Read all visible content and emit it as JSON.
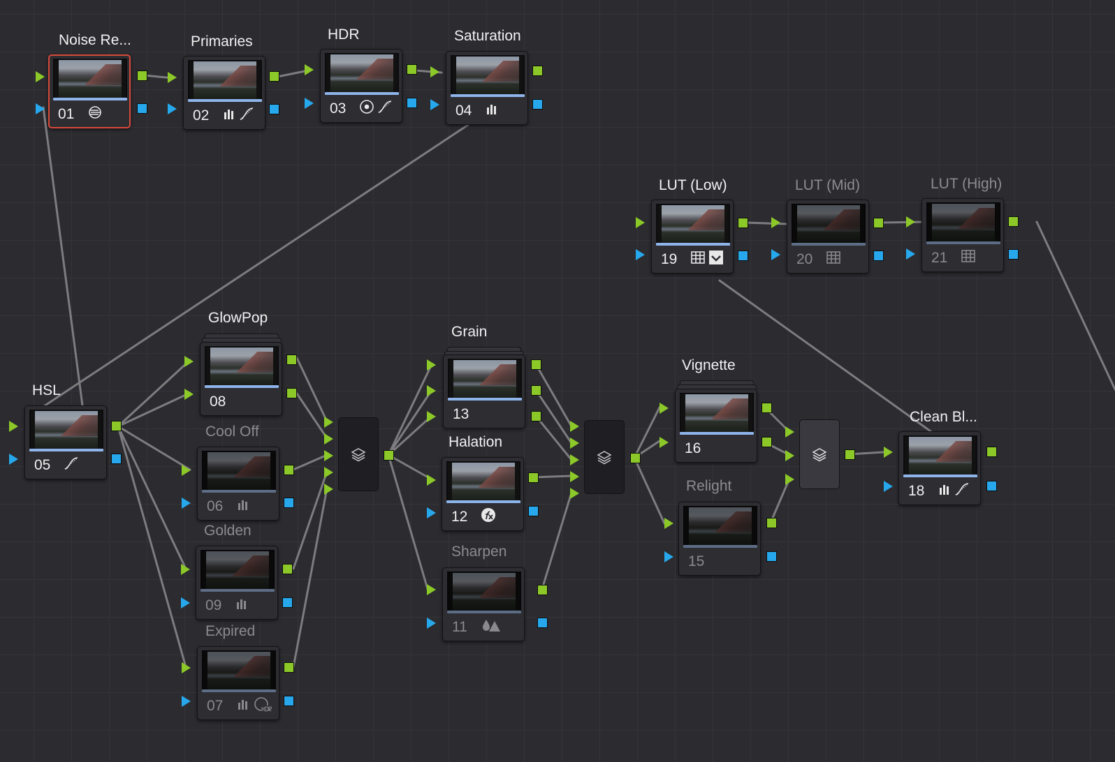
{
  "nodes": {
    "n01": {
      "label": "Noise Re...",
      "num": "01"
    },
    "n02": {
      "label": "Primaries",
      "num": "02"
    },
    "n03": {
      "label": "HDR",
      "num": "03"
    },
    "n04": {
      "label": "Saturation",
      "num": "04"
    },
    "n05": {
      "label": "HSL",
      "num": "05"
    },
    "n06": {
      "label": "Cool Off",
      "num": "06"
    },
    "n07": {
      "label": "Expired",
      "num": "07"
    },
    "n08": {
      "label": "GlowPop",
      "num": "08"
    },
    "n09": {
      "label": "Golden",
      "num": "09"
    },
    "n11": {
      "label": "Sharpen",
      "num": "11"
    },
    "n12": {
      "label": "Halation",
      "num": "12"
    },
    "n13": {
      "label": "Grain",
      "num": "13"
    },
    "n15": {
      "label": "Relight",
      "num": "15"
    },
    "n16": {
      "label": "Vignette",
      "num": "16"
    },
    "n18": {
      "label": "Clean Bl...",
      "num": "18"
    },
    "n19": {
      "label": "LUT (Low)",
      "num": "19"
    },
    "n20": {
      "label": "LUT (Mid)",
      "num": "20"
    },
    "n21": {
      "label": "LUT (High)",
      "num": "21"
    }
  },
  "colors": {
    "background": "#2b2b30",
    "rgb_connector": "#8cc928",
    "alpha_connector": "#27a8ec",
    "selected_outline": "#d84a3a",
    "wire": "#7d7d80"
  }
}
